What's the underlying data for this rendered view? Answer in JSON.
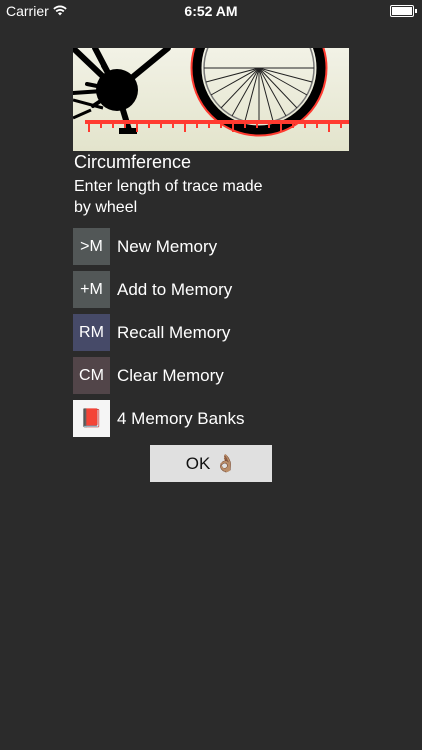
{
  "status_bar": {
    "carrier": "Carrier",
    "time": "6:52 AM"
  },
  "header": {
    "title": "Circumference",
    "subtitle": "Enter length of trace made by wheel"
  },
  "menu": {
    "items": [
      {
        "icon_text": ">M",
        "label": "New Memory",
        "color": "#525757"
      },
      {
        "icon_text": "+M",
        "label": "Add to Memory",
        "color": "#525757"
      },
      {
        "icon_text": "RM",
        "label": "Recall Memory",
        "color": "#464a68"
      },
      {
        "icon_text": "CM",
        "label": "Clear Memory",
        "color": "#524549"
      },
      {
        "icon_text": "📕",
        "label": "4 Memory Banks",
        "color": "#f5f5f5"
      }
    ]
  },
  "ok_button": {
    "label": "OK 👌🏽"
  },
  "colors": {
    "background": "#2b2b2b",
    "ruler_red": "#ff3b30",
    "button_bg": "#e0e0e0"
  }
}
